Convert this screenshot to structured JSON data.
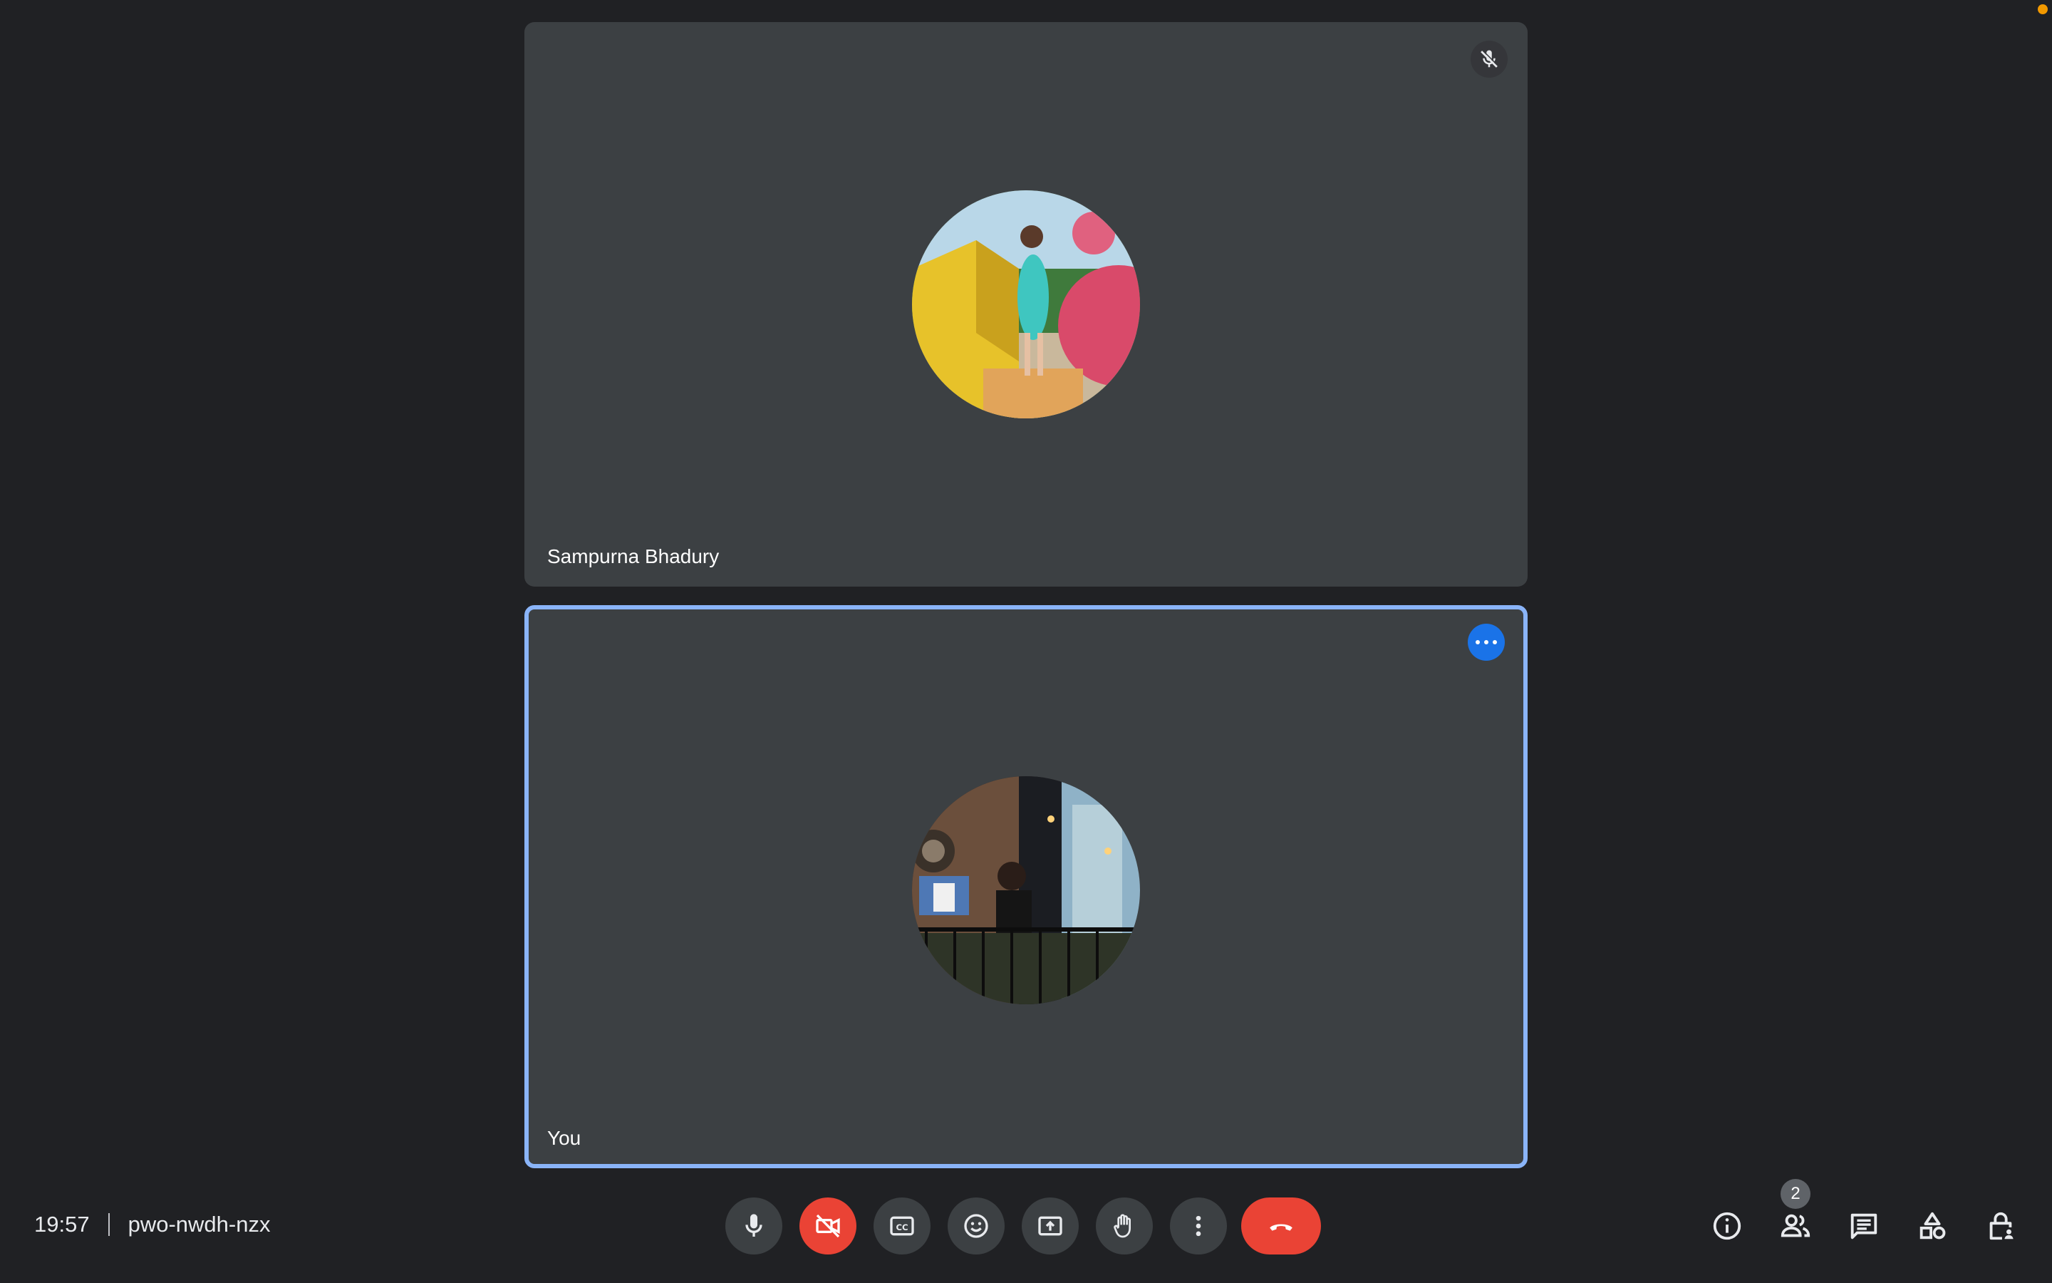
{
  "participants": [
    {
      "name": "Sampurna Bhadury",
      "muted": true,
      "icon": "mic-off-icon"
    },
    {
      "name": "You",
      "active": true,
      "icon": "more-horiz-icon"
    }
  ],
  "meeting": {
    "time": "19:57",
    "code": "pwo-nwdh-nzx"
  },
  "controls": [
    {
      "name": "microphone-button",
      "icon": "mic-icon",
      "state": "on"
    },
    {
      "name": "camera-button",
      "icon": "videocam-off-icon",
      "state": "off"
    },
    {
      "name": "captions-button",
      "icon": "closed-caption-icon"
    },
    {
      "name": "reactions-button",
      "icon": "emoji-icon"
    },
    {
      "name": "present-button",
      "icon": "present-to-all-icon"
    },
    {
      "name": "raise-hand-button",
      "icon": "hand-icon"
    },
    {
      "name": "more-options-button",
      "icon": "more-vert-icon"
    },
    {
      "name": "leave-call-button",
      "icon": "call-end-icon"
    }
  ],
  "side_controls": {
    "info_icon": "info-icon",
    "people_icon": "people-icon",
    "people_count": "2",
    "chat_icon": "chat-icon",
    "activities_icon": "activities-icon",
    "host_controls_icon": "lock-person-icon"
  },
  "colors": {
    "background": "#202124",
    "tile": "#3c4043",
    "active_border": "#8ab4f8",
    "danger": "#ea4335",
    "accent": "#1a73e8"
  }
}
